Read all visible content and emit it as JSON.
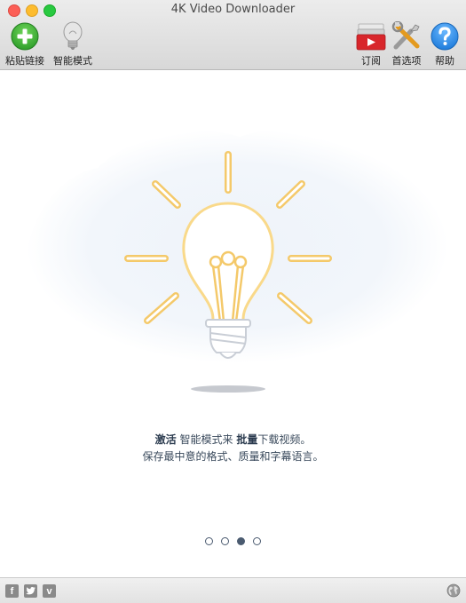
{
  "window": {
    "title": "4K Video Downloader"
  },
  "toolbar": {
    "paste_link": "粘贴链接",
    "smart_mode": "智能模式",
    "subscribe": "订阅",
    "preferences": "首选项",
    "help": "帮助"
  },
  "onboarding": {
    "line1_bold1": "激活",
    "line1_text1": " 智能模式来 ",
    "line1_bold2": "批量",
    "line1_text2": "下载视频。",
    "line2": "保存最中意的格式、质量和字幕语言。",
    "pagination": {
      "total": 4,
      "active_index": 2
    }
  },
  "footer": {
    "icons": [
      "facebook-icon",
      "twitter-icon",
      "vimeo-icon",
      "globe-icon"
    ]
  },
  "colors": {
    "paste_green": "#3fb83a",
    "bulb_yellow": "#f9d98a",
    "help_blue": "#2d8fe6",
    "dot_dark": "#4b5b70"
  }
}
